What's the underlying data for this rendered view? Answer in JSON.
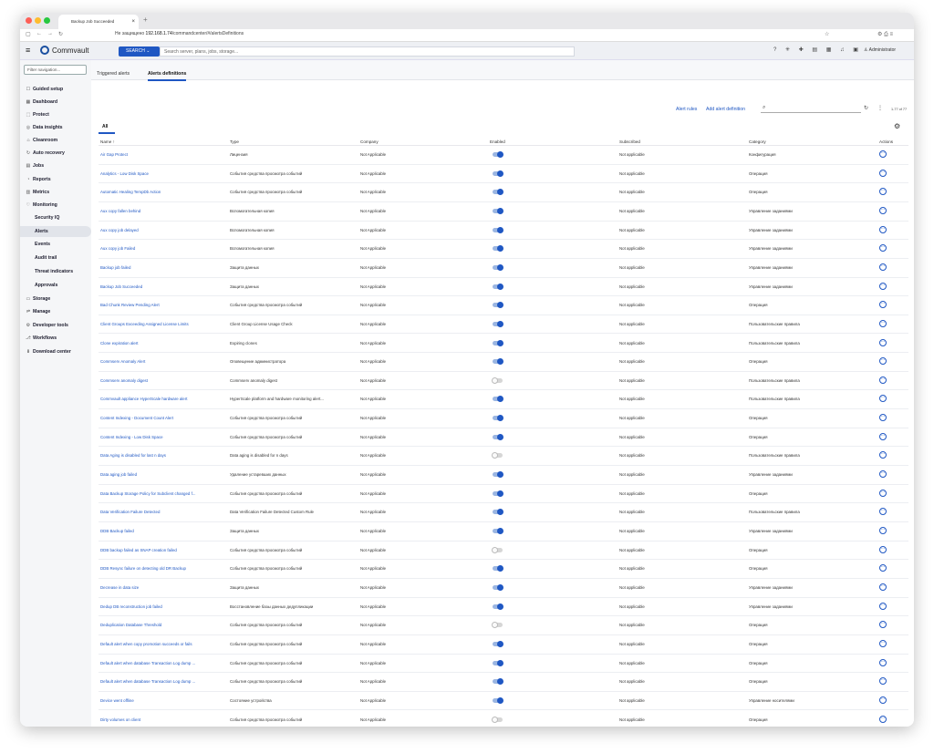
{
  "browser": {
    "tab_title": "Backup Job Succeeded",
    "insecure_label": "Не защищено",
    "url_host": "192.168.1.74",
    "url_path": "/commandcenter/#/alertsDefinitions"
  },
  "app": {
    "logo_text": "Commvault",
    "search_label": "SEARCH",
    "search_placeholder": "Search server, plans, jobs, storage...",
    "user": "Administrator"
  },
  "sidebar": {
    "filter_placeholder": "Filter navigation...",
    "items": [
      {
        "label": "Guided setup",
        "icon": "☐"
      },
      {
        "label": "Dashboard",
        "icon": "▦"
      },
      {
        "label": "Protect",
        "icon": "⬚"
      },
      {
        "label": "Data insights",
        "icon": "◎"
      },
      {
        "label": "Cleanroom",
        "icon": "⌂"
      },
      {
        "label": "Auto recovery",
        "icon": "↻"
      },
      {
        "label": "Jobs",
        "icon": "▤"
      },
      {
        "label": "Reports",
        "icon": "◔"
      },
      {
        "label": "Metrics",
        "icon": "▥"
      },
      {
        "label": "Monitoring",
        "icon": "♡"
      },
      {
        "label": "Security IQ",
        "icon": ""
      },
      {
        "label": "Alerts",
        "icon": ""
      },
      {
        "label": "Events",
        "icon": ""
      },
      {
        "label": "Audit trail",
        "icon": ""
      },
      {
        "label": "Threat indicators",
        "icon": ""
      },
      {
        "label": "Approvals",
        "icon": ""
      },
      {
        "label": "Storage",
        "icon": "▭"
      },
      {
        "label": "Manage",
        "icon": "⇌"
      },
      {
        "label": "Developer tools",
        "icon": "⚙"
      },
      {
        "label": "Workflows",
        "icon": "⎇"
      },
      {
        "label": "Download center",
        "icon": "⬇"
      }
    ]
  },
  "page": {
    "tabs": [
      "Triggered alerts",
      "Alerts definitions"
    ],
    "alert_rules": "Alert rules",
    "add_alert": "Add alert definition",
    "pager": "1-77 of 77",
    "view_tab": "All"
  },
  "table": {
    "columns": [
      "Name ↑",
      "Type",
      "Company",
      "Enabled",
      "Subscribed",
      "Category",
      "Actions"
    ],
    "rows": [
      {
        "name": "Air Gap Protect",
        "type": "Лицензия",
        "company": "Not Applicable",
        "enabled": true,
        "subscribed": "Not applicable",
        "category": "Конфигурация"
      },
      {
        "name": "Analytics - Low Disk Space",
        "type": "События средства просмотра событий",
        "company": "Not Applicable",
        "enabled": true,
        "subscribed": "Not applicable",
        "category": "Операция"
      },
      {
        "name": "Automatic Healing TempDb Action",
        "type": "События средства просмотра событий",
        "company": "Not Applicable",
        "enabled": true,
        "subscribed": "Not applicable",
        "category": "Операция"
      },
      {
        "name": "Aux copy fallen behind",
        "type": "Вспомогательная копия",
        "company": "Not Applicable",
        "enabled": true,
        "subscribed": "Not applicable",
        "category": "Управление заданиями"
      },
      {
        "name": "Aux copy job delayed",
        "type": "Вспомогательная копия",
        "company": "Not Applicable",
        "enabled": true,
        "subscribed": "Not applicable",
        "category": "Управление заданиями"
      },
      {
        "name": "Aux copy job Failed",
        "type": "Вспомогательная копия",
        "company": "Not Applicable",
        "enabled": true,
        "subscribed": "Not applicable",
        "category": "Управление заданиями"
      },
      {
        "name": "Backup job failed",
        "type": "Защита данных",
        "company": "Not Applicable",
        "enabled": true,
        "subscribed": "Not applicable",
        "category": "Управление заданиями"
      },
      {
        "name": "Backup Job Succeeded",
        "type": "Защита данных",
        "company": "Not Applicable",
        "enabled": true,
        "subscribed": "Not applicable",
        "category": "Управление заданиями"
      },
      {
        "name": "Bad Chunk Review Pending Alert",
        "type": "События средства просмотра событий",
        "company": "Not Applicable",
        "enabled": true,
        "subscribed": "Not applicable",
        "category": "Операция"
      },
      {
        "name": "Client Groups Exceeding Assigned License Limits",
        "type": "Client Group License Usage Check",
        "company": "Not Applicable",
        "enabled": true,
        "subscribed": "Not applicable",
        "category": "Пользовательские правила"
      },
      {
        "name": "Clone expiration alert",
        "type": "Expiring clones",
        "company": "Not Applicable",
        "enabled": true,
        "subscribed": "Not applicable",
        "category": "Пользовательские правила"
      },
      {
        "name": "Commserv Anomaly Alert",
        "type": "Оповещение администратора",
        "company": "Not Applicable",
        "enabled": true,
        "subscribed": "Not applicable",
        "category": "Операция"
      },
      {
        "name": "Commserv anomaly digest",
        "type": "Commserv anomaly digest",
        "company": "Not Applicable",
        "enabled": false,
        "subscribed": "Not applicable",
        "category": "Пользовательские правила"
      },
      {
        "name": "Commvault appliance HyperScale hardware alert",
        "type": "HyperScale platform and hardware monitoring alert...",
        "company": "Not Applicable",
        "enabled": true,
        "subscribed": "Not applicable",
        "category": "Пользовательские правила"
      },
      {
        "name": "Content Indexing - Document Count Alert",
        "type": "События средства просмотра событий",
        "company": "Not Applicable",
        "enabled": true,
        "subscribed": "Not applicable",
        "category": "Операция"
      },
      {
        "name": "Content Indexing - Low Disk Space",
        "type": "События средства просмотра событий",
        "company": "Not Applicable",
        "enabled": true,
        "subscribed": "Not applicable",
        "category": "Операция"
      },
      {
        "name": "Data Aging is disabled for last n days",
        "type": "Data aging is disabled for n days",
        "company": "Not Applicable",
        "enabled": false,
        "subscribed": "Not applicable",
        "category": "Пользовательские правила"
      },
      {
        "name": "Data aging job failed",
        "type": "Удаление устаревших данных",
        "company": "Not Applicable",
        "enabled": true,
        "subscribed": "Not applicable",
        "category": "Управление заданиями"
      },
      {
        "name": "Data Backup Storage Policy for Subclient changed f...",
        "type": "События средства просмотра событий",
        "company": "Not Applicable",
        "enabled": true,
        "subscribed": "Not applicable",
        "category": "Операция"
      },
      {
        "name": "Data Verification Failure Detected",
        "type": "Data Verification Failure Detected Custom Rule",
        "company": "Not Applicable",
        "enabled": true,
        "subscribed": "Not applicable",
        "category": "Пользовательские правила"
      },
      {
        "name": "DDB Backup failed",
        "type": "Защита данных",
        "company": "Not Applicable",
        "enabled": true,
        "subscribed": "Not applicable",
        "category": "Управление заданиями"
      },
      {
        "name": "DDB backup failed as SNAP creation failed",
        "type": "События средства просмотра событий",
        "company": "Not Applicable",
        "enabled": false,
        "subscribed": "Not applicable",
        "category": "Операция"
      },
      {
        "name": "DDB Resync failure on detecting old DR Backup",
        "type": "События средства просмотра событий",
        "company": "Not Applicable",
        "enabled": true,
        "subscribed": "Not applicable",
        "category": "Операция"
      },
      {
        "name": "Decrease in data size",
        "type": "Защита данных",
        "company": "Not Applicable",
        "enabled": true,
        "subscribed": "Not applicable",
        "category": "Управление заданиями"
      },
      {
        "name": "Dedup DB reconstruction job failed",
        "type": "Восстановление базы данных дедупликации",
        "company": "Not Applicable",
        "enabled": true,
        "subscribed": "Not applicable",
        "category": "Управление заданиями"
      },
      {
        "name": "Deduplication Database Threshold",
        "type": "События средства просмотра событий",
        "company": "Not Applicable",
        "enabled": false,
        "subscribed": "Not applicable",
        "category": "Операция"
      },
      {
        "name": "Default alert when copy promotion succeeds or fails",
        "type": "События средства просмотра событий",
        "company": "Not Applicable",
        "enabled": true,
        "subscribed": "Not applicable",
        "category": "Операция"
      },
      {
        "name": "Default alert when database Transaction Log dump ...",
        "type": "События средства просмотра событий",
        "company": "Not Applicable",
        "enabled": true,
        "subscribed": "Not applicable",
        "category": "Операция"
      },
      {
        "name": "Default alert when database Transaction Log dump ...",
        "type": "События средства просмотра событий",
        "company": "Not Applicable",
        "enabled": true,
        "subscribed": "Not applicable",
        "category": "Операция"
      },
      {
        "name": "Device went offline",
        "type": "Состояние устройства",
        "company": "Not Applicable",
        "enabled": true,
        "subscribed": "Not applicable",
        "category": "Управление носителями"
      },
      {
        "name": "Dirty volumes on client",
        "type": "События средства просмотра событий",
        "company": "Not Applicable",
        "enabled": false,
        "subscribed": "Not applicable",
        "category": "Операция"
      }
    ]
  }
}
